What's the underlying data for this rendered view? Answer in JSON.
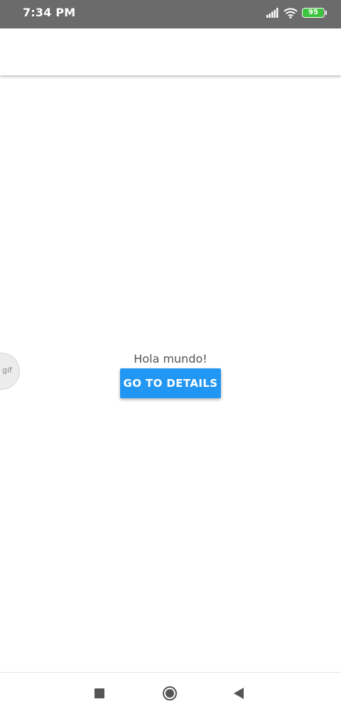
{
  "status_bar": {
    "time": "7:34 PM",
    "battery_level": "95",
    "battery_fraction": 0.95,
    "battery_color": "#3cc43c",
    "icons": [
      "signal-icon",
      "wifi-icon",
      "battery-icon"
    ]
  },
  "app_bar": {
    "title": ""
  },
  "main": {
    "greeting": "Hola mundo!",
    "button_label": "GO TO DETAILS",
    "button_color": "#2196f3"
  },
  "floating_bubble": {
    "label": "gif"
  },
  "nav_bar": {
    "icons": [
      "recents-icon",
      "home-icon",
      "back-icon"
    ]
  }
}
